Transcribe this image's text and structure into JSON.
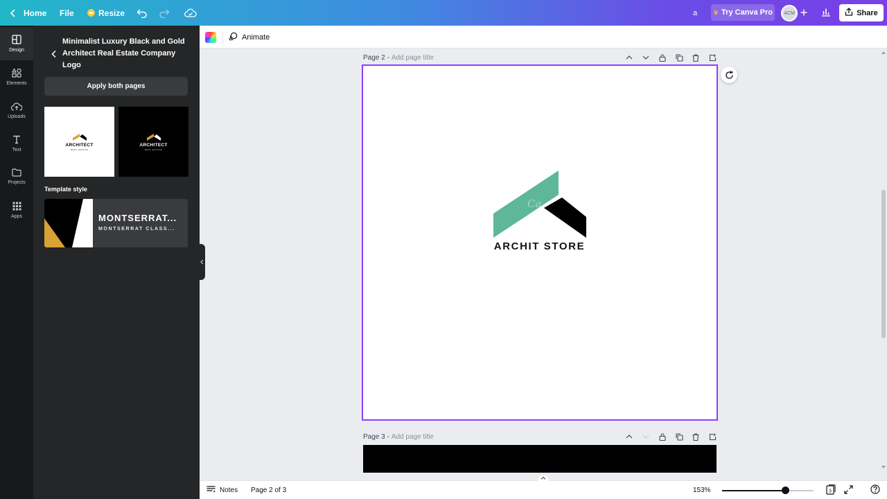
{
  "topbar": {
    "home_label": "Home",
    "file_label": "File",
    "resize_label": "Resize",
    "user_initial": "a",
    "try_pro_label": "Try Canva Pro",
    "avatar_text": "ACM",
    "share_label": "Share"
  },
  "rail": {
    "items": [
      {
        "label": "Design",
        "icon": "design-icon"
      },
      {
        "label": "Elements",
        "icon": "elements-icon"
      },
      {
        "label": "Uploads",
        "icon": "uploads-icon"
      },
      {
        "label": "Text",
        "icon": "text-icon"
      },
      {
        "label": "Projects",
        "icon": "projects-icon"
      },
      {
        "label": "Apps",
        "icon": "apps-icon"
      }
    ]
  },
  "panel": {
    "template_title": "Minimalist Luxury Black and Gold Architect Real Estate Company Logo",
    "apply_label": "Apply both pages",
    "thumb_word": "ARCHITECT",
    "thumb_sub": "REAL ESTATE",
    "template_style_label": "Template style",
    "style_font_primary": "MONTSERRAT...",
    "style_font_secondary": "MONTSERRAT CLASS..."
  },
  "toolbar": {
    "animate_label": "Animate"
  },
  "canvas": {
    "page2_label": "Page 2 -",
    "page3_label": "Page 3 -",
    "page_title_placeholder": "Add page title",
    "logo_text": "ARCHIT STORE",
    "logo_watermark": "Ca"
  },
  "colors": {
    "accent": "#8b3dff",
    "logo_green": "#5fb79a",
    "gold": "#d8a235"
  },
  "footer": {
    "notes_label": "Notes",
    "page_indicator": "Page 2 of 3",
    "zoom_level": "153%",
    "zoom_slider_fraction": 0.69,
    "pages_count": "3"
  }
}
